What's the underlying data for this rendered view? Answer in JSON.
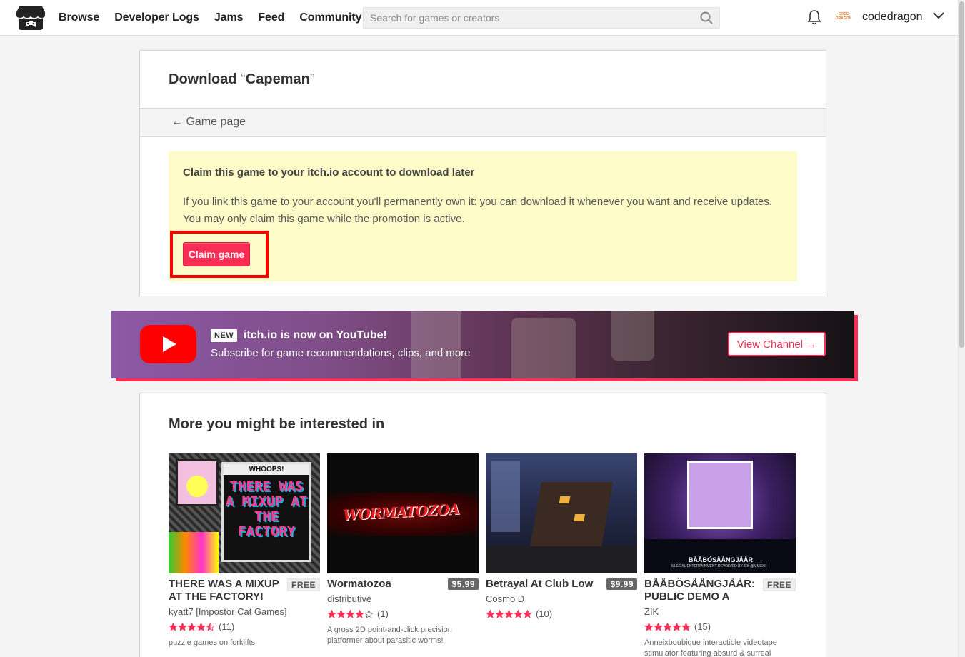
{
  "header": {
    "nav": [
      "Browse",
      "Developer Logs",
      "Jams",
      "Feed",
      "Community"
    ],
    "search_placeholder": "Search for games or creators",
    "avatar_text": "CODE DRAGON",
    "username": "codedragon"
  },
  "download": {
    "title_prefix": "Download ",
    "open_quote": "“",
    "game_name": "Capeman",
    "close_quote": "”",
    "back_link": "← Game page",
    "claim_title": "Claim this game to your itch.io account to download later",
    "claim_body": "If you link this game to your account you'll permanently own it: you can download it whenever you want and receive updates. You may only claim this game while the promotion is active.",
    "claim_button": "Claim game"
  },
  "banner": {
    "badge": "NEW",
    "headline": "itch.io is now on YouTube!",
    "subline": "Subscribe for game recommendations, clips, and more",
    "button": "View Channel →"
  },
  "recommendations": {
    "heading": "More you might be interested in",
    "games": [
      {
        "title": "THERE WAS A MIXUP AT THE FACTORY!",
        "price": "FREE",
        "author": "kyatt7 [Impostor Cat Games]",
        "stars": 4.5,
        "count": "(11)",
        "desc": "puzzle games on forklifts",
        "thumb_text": "THERE WAS A MIXUP AT THE FACTORY",
        "thumb_banner": "WHOOPS!"
      },
      {
        "title": "Wormatozoa",
        "price": "$5.99",
        "author": "distributive",
        "stars": 4,
        "count": "(1)",
        "desc": "A gross 2D point-and-click precision platformer about parasitic worms!",
        "thumb_text": "WORMATOZOA"
      },
      {
        "title": "Betrayal At Club Low",
        "price": "$9.99",
        "author": "Cosmo D",
        "stars": 5,
        "count": "(10)",
        "desc": ""
      },
      {
        "title": "BÅÅBÖSÅÅNGJÅÅR: PUBLIC DEMO A",
        "price": "FREE",
        "author": "ZIK",
        "stars": 5,
        "count": "(15)",
        "desc": "Anneixboubique interactible videotape stimulator featuring absurd & surreal",
        "thumb_text": "BÅÅBÖSÅÅNGJÅÅR",
        "thumb_sub": "ILLEGAL ENTERTAINMENT DEVOLVED BY ZIK @MMXXII"
      }
    ]
  },
  "colors": {
    "accent": "#fa2d55",
    "claim_bg": "#fdfbc7",
    "highlight": "#ff0000"
  }
}
